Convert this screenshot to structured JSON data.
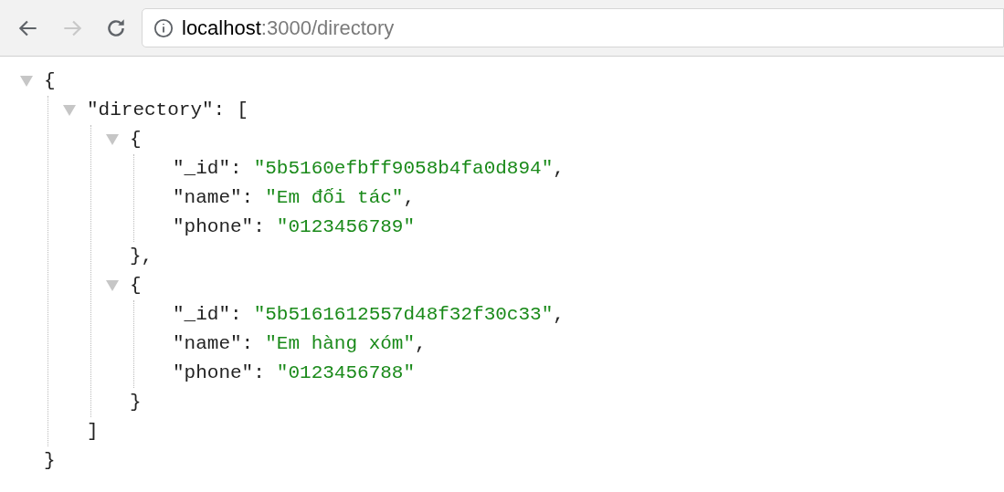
{
  "browser": {
    "back_disabled": false,
    "forward_disabled": true,
    "url_host": "localhost",
    "url_rest": ":3000/directory"
  },
  "viewer": {
    "kind": "container",
    "open": "{",
    "close": "}",
    "expanded": true,
    "children": [
      {
        "kind": "container",
        "key": "\"directory\":",
        "open": "[",
        "close": "]",
        "expanded": true,
        "children": [
          {
            "kind": "container",
            "open": "{",
            "close": "},",
            "expanded": true,
            "children": [
              {
                "kind": "pair",
                "key": "\"_id\":",
                "value": "\"5b5160efbff9058b4fa0d894\"",
                "comma": ","
              },
              {
                "kind": "pair",
                "key": "\"name\":",
                "value": "\"Em đối tác\"",
                "comma": ","
              },
              {
                "kind": "pair",
                "key": "\"phone\":",
                "value": "\"0123456789\""
              }
            ]
          },
          {
            "kind": "container",
            "open": "{",
            "close": "}",
            "expanded": true,
            "children": [
              {
                "kind": "pair",
                "key": "\"_id\":",
                "value": "\"5b5161612557d48f32f30c33\"",
                "comma": ","
              },
              {
                "kind": "pair",
                "key": "\"name\":",
                "value": "\"Em hàng xóm\"",
                "comma": ","
              },
              {
                "kind": "pair",
                "key": "\"phone\":",
                "value": "\"0123456788\""
              }
            ]
          }
        ]
      }
    ]
  }
}
